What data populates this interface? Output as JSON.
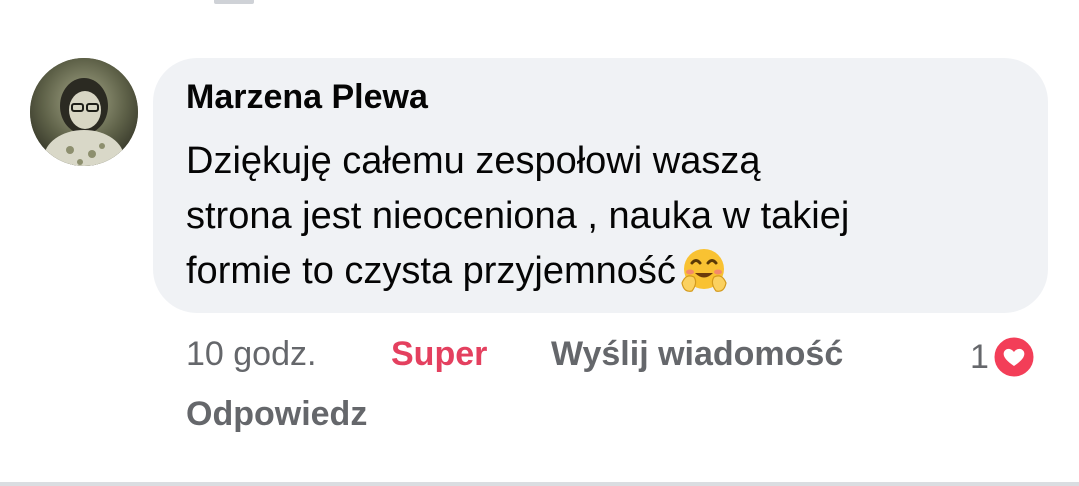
{
  "comment": {
    "author": "Marzena Plewa",
    "text_lines": [
      "Dziękuję całemu zespołowi waszą",
      "strona jest nieoceniona , nauka w takiej",
      "formie to czysta przyjemność"
    ],
    "emoji_icon": "hugging-face-emoji"
  },
  "actions": {
    "time": "10 godz.",
    "reaction": "Super",
    "send_message": "Wyślij wiadomość",
    "reply": "Odpowiedz"
  },
  "reactions": {
    "count": "1",
    "icon": "heart-icon",
    "color": "#f33e58"
  },
  "colors": {
    "bubble": "#f0f2f5",
    "super_accent": "#e4405f",
    "secondary_text": "#65676b"
  }
}
